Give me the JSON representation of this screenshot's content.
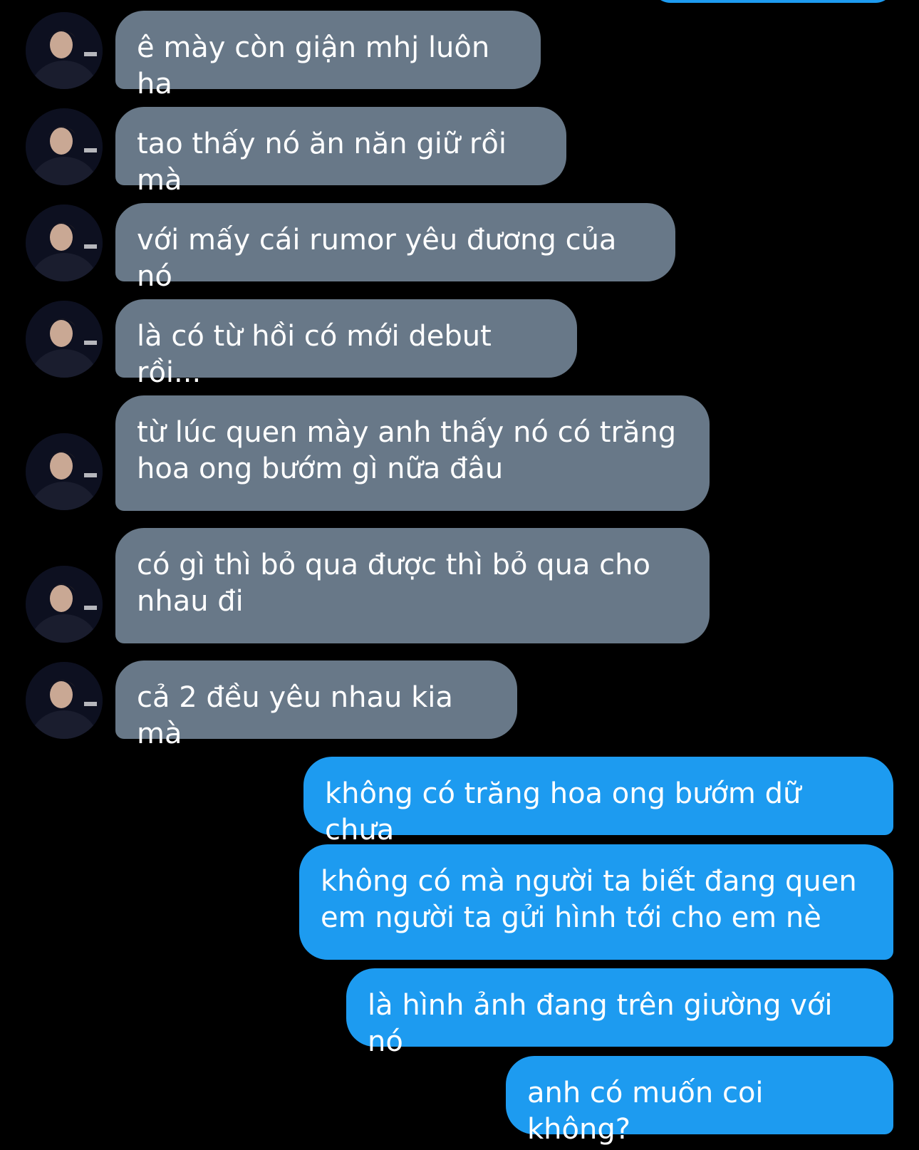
{
  "conversation": {
    "incoming": [
      {
        "text": "ê mày còn giận mhj luôn ha",
        "avatar": "contact-avatar"
      },
      {
        "text": "tao thấy nó ăn năn giữ rồi mà",
        "avatar": "contact-avatar"
      },
      {
        "text": "với mấy cái rumor yêu đương của nó",
        "avatar": "contact-avatar"
      },
      {
        "text": "là có từ hồi có mới debut rồi...",
        "avatar": "contact-avatar"
      },
      {
        "text": "từ lúc quen mày anh thấy nó có trăng\nhoa ong bướm gì nữa đâu",
        "avatar": "contact-avatar"
      },
      {
        "text": "có gì thì bỏ qua được thì bỏ qua cho\nnhau đi",
        "avatar": "contact-avatar"
      },
      {
        "text": "cả 2 đều yêu nhau kia mà",
        "avatar": "contact-avatar"
      }
    ],
    "outgoing": [
      {
        "text": "không có trăng hoa ong bướm dữ chưa"
      },
      {
        "text": "không có mà người ta biết đang quen\nem người ta gửi hình tới cho em nè"
      },
      {
        "text": "là hình ảnh đang trên giường với nó"
      },
      {
        "text": "anh có muốn coi không?"
      }
    ]
  },
  "colors": {
    "background": "#000000",
    "incoming_bubble": "#687888",
    "outgoing_bubble": "#1d9bf0",
    "text": "#ffffff"
  }
}
